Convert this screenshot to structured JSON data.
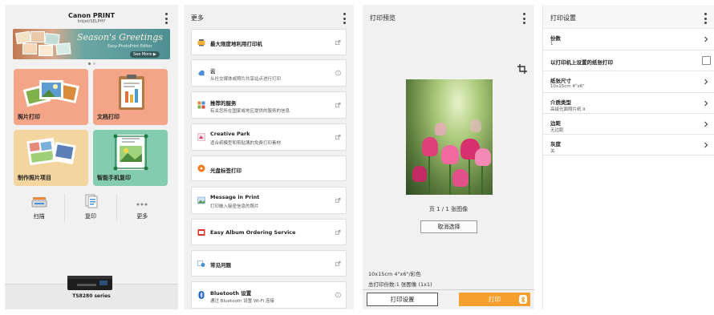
{
  "home": {
    "brand": "Canon PRINT",
    "brand_sub": "Inkjet/SELPHY",
    "banner": {
      "title": "Season's Greetings",
      "subtitle": "Easy-PhotoPrint Editor",
      "more": "See More ▶"
    },
    "tiles": [
      {
        "label": "照片打印"
      },
      {
        "label": "文档打印"
      },
      {
        "label": "制作照片项目"
      },
      {
        "label": "智能手机复印"
      }
    ],
    "toolbar": [
      {
        "label": "扫描"
      },
      {
        "label": "复印"
      },
      {
        "label": "更多"
      }
    ],
    "printer": "TS8280 series"
  },
  "more": {
    "title": "更多",
    "items": [
      {
        "title": "最大限度地利用打印机",
        "subtitle": "",
        "icon": "printer-star-icon",
        "accessory": "external-link-icon"
      },
      {
        "title": "云",
        "subtitle": "从社交媒体或照片共享站点进行打印",
        "icon": "cloud-icon",
        "accessory": "help-icon"
      },
      {
        "title": "推荐的服务",
        "subtitle": "有关您所在国家或地区提供的服务的信息",
        "icon": "services-grid-icon",
        "accessory": "external-link-icon"
      },
      {
        "title": "Creative Park",
        "subtitle": "适合纸模型和剪贴簿的免费打印素材",
        "icon": "creative-park-icon",
        "accessory": "external-link-icon"
      },
      {
        "title": "光盘标签打印",
        "subtitle": "",
        "icon": "disc-icon",
        "accessory": ""
      },
      {
        "title": "Message in Print",
        "subtitle": "打印嵌入秘密信息的照片",
        "icon": "message-photo-icon",
        "accessory": "external-link-icon"
      },
      {
        "title": "Easy Album Ordering Service",
        "subtitle": "",
        "icon": "album-icon",
        "accessory": "external-link-icon"
      },
      {
        "title": "常见问题",
        "subtitle": "",
        "icon": "faq-icon",
        "accessory": "external-link-icon"
      },
      {
        "title": "Bluetooth 设置",
        "subtitle": "通过 Bluetooth 设置 Wi-Fi 连接",
        "icon": "bluetooth-icon",
        "accessory": "help-icon"
      }
    ]
  },
  "preview": {
    "title": "打印预览",
    "page_indicator": "页 1 / 1 张图像",
    "cancel_label": "取消选择",
    "paper_info": "10x15cm 4\"x6\"/彩色",
    "total_copies": "总打印份数:1 张图像 (1x1)",
    "settings_label": "打印设置",
    "print_label": "打印"
  },
  "settings": {
    "title": "打印设置",
    "rows": [
      {
        "key": "份数",
        "value": "1"
      },
      {
        "key": "以打印机上设置的纸张打印",
        "value": ""
      },
      {
        "key": "纸张尺寸",
        "value": "10x15cm 4\"x6\""
      },
      {
        "key": "介质类型",
        "value": "高级光面照片纸 II"
      },
      {
        "key": "边距",
        "value": "无边距"
      },
      {
        "key": "灰度",
        "value": "关"
      }
    ]
  },
  "colors": {
    "accent": "#f5a02c",
    "tile_photo": "#f4a588",
    "tile_project": "#f3d69f",
    "tile_copy": "#84ccaf"
  }
}
